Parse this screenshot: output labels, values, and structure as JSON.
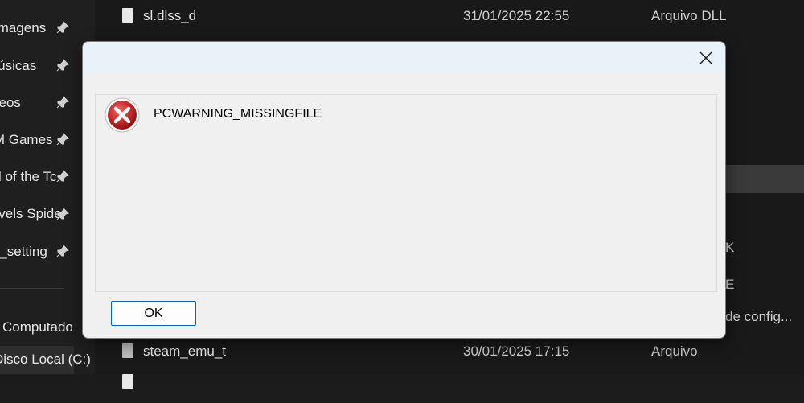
{
  "sidebar": {
    "items": [
      {
        "label": "Imagens",
        "pinned": true
      },
      {
        "label": "Músicas",
        "pinned": true
      },
      {
        "label": "Vídeos",
        "pinned": true
      },
      {
        "label": "EMPRESS M Games",
        "pinned": true
      },
      {
        "label": "Legend of the Tc",
        "pinned": true
      },
      {
        "label": "Marvels Spide",
        "pinned": true
      },
      {
        "label": "steam_setting",
        "pinned": true
      }
    ],
    "this_pc": "Computado",
    "local_disk": "Disco Local (C:)"
  },
  "files": [
    {
      "name": "sl.dlss_d",
      "date": "31/01/2025 22:55",
      "type": "Arquivo DLL"
    },
    {
      "name": "",
      "date": "",
      "type": "de config..."
    },
    {
      "name": "steam_emu_t",
      "date": "30/01/2025 17:15",
      "type": "Arquivo"
    }
  ],
  "partial_types": [
    "K",
    "E"
  ],
  "dialog": {
    "message": "PCWARNING_MISSINGFILE",
    "ok_label": "OK",
    "icon": "error-icon"
  },
  "colors": {
    "accent": "#0067c0",
    "error_red": "#c42b2b"
  }
}
